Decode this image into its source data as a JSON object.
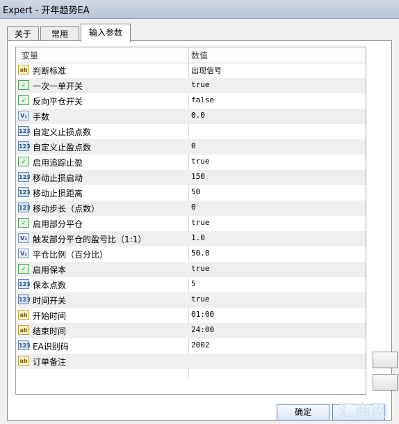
{
  "window": {
    "title": "Expert - 开年趋势EA"
  },
  "tabs": [
    "关于",
    "常用",
    "输入参数"
  ],
  "grid": {
    "headers": [
      "变量",
      "数值"
    ],
    "rows": [
      {
        "icon": "ab",
        "type": "str",
        "name": "判断标准",
        "value": "出现信号"
      },
      {
        "icon": "✓",
        "type": "bool",
        "name": "一次一单开关",
        "value": "true"
      },
      {
        "icon": "✓",
        "type": "bool",
        "name": "反向平仓开关",
        "value": "false"
      },
      {
        "icon": "V₂",
        "type": "dbl",
        "name": "手数",
        "value": "0.0"
      },
      {
        "icon": "123",
        "type": "num",
        "name": "自定义止损点数",
        "value": ""
      },
      {
        "icon": "123",
        "type": "num",
        "name": "自定义止盈点数",
        "value": "0"
      },
      {
        "icon": "✓",
        "type": "bool",
        "name": "启用追踪止盈",
        "value": "true"
      },
      {
        "icon": "123",
        "type": "num",
        "name": "移动止损启动",
        "value": "150"
      },
      {
        "icon": "123",
        "type": "num",
        "name": "移动止损距离",
        "value": "50"
      },
      {
        "icon": "123",
        "type": "num",
        "name": "移动步长（点数）",
        "value": "0"
      },
      {
        "icon": "✓",
        "type": "bool",
        "name": "启用部分平仓",
        "value": "true"
      },
      {
        "icon": "V₂",
        "type": "dbl",
        "name": "触发部分平仓的盈亏比（1:1）",
        "value": "1.0"
      },
      {
        "icon": "V₂",
        "type": "dbl",
        "name": "平仓比例（百分比）",
        "value": "50.0"
      },
      {
        "icon": "✓",
        "type": "bool",
        "name": "启用保本",
        "value": "true"
      },
      {
        "icon": "123",
        "type": "num",
        "name": "保本点数",
        "value": "5"
      },
      {
        "icon": "123",
        "type": "num",
        "name": "时间开关",
        "value": "true"
      },
      {
        "icon": "ab",
        "type": "str",
        "name": "开始时间",
        "value": "01:00"
      },
      {
        "icon": "ab",
        "type": "str",
        "name": "结束时间",
        "value": "24:00"
      },
      {
        "icon": "123",
        "type": "num",
        "name": "EA识别码",
        "value": "2002"
      },
      {
        "icon": "ab",
        "type": "str",
        "name": "订单备注",
        "value": ""
      }
    ]
  },
  "buttons": {
    "ok": "确定"
  },
  "watermark": "汇商网"
}
